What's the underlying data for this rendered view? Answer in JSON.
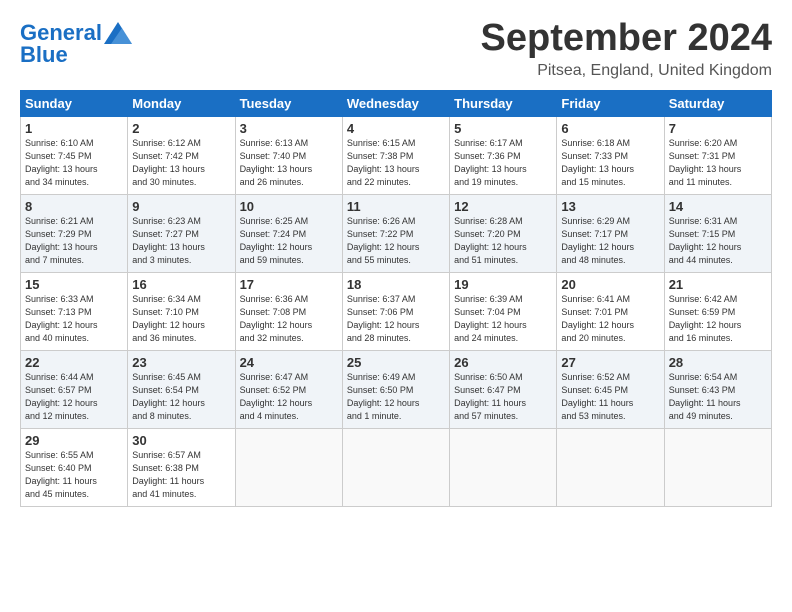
{
  "logo": {
    "line1": "General",
    "line2": "Blue"
  },
  "title": "September 2024",
  "location": "Pitsea, England, United Kingdom",
  "days_of_week": [
    "Sunday",
    "Monday",
    "Tuesday",
    "Wednesday",
    "Thursday",
    "Friday",
    "Saturday"
  ],
  "weeks": [
    [
      {
        "day": "1",
        "info": "Sunrise: 6:10 AM\nSunset: 7:45 PM\nDaylight: 13 hours\nand 34 minutes."
      },
      {
        "day": "2",
        "info": "Sunrise: 6:12 AM\nSunset: 7:42 PM\nDaylight: 13 hours\nand 30 minutes."
      },
      {
        "day": "3",
        "info": "Sunrise: 6:13 AM\nSunset: 7:40 PM\nDaylight: 13 hours\nand 26 minutes."
      },
      {
        "day": "4",
        "info": "Sunrise: 6:15 AM\nSunset: 7:38 PM\nDaylight: 13 hours\nand 22 minutes."
      },
      {
        "day": "5",
        "info": "Sunrise: 6:17 AM\nSunset: 7:36 PM\nDaylight: 13 hours\nand 19 minutes."
      },
      {
        "day": "6",
        "info": "Sunrise: 6:18 AM\nSunset: 7:33 PM\nDaylight: 13 hours\nand 15 minutes."
      },
      {
        "day": "7",
        "info": "Sunrise: 6:20 AM\nSunset: 7:31 PM\nDaylight: 13 hours\nand 11 minutes."
      }
    ],
    [
      {
        "day": "8",
        "info": "Sunrise: 6:21 AM\nSunset: 7:29 PM\nDaylight: 13 hours\nand 7 minutes."
      },
      {
        "day": "9",
        "info": "Sunrise: 6:23 AM\nSunset: 7:27 PM\nDaylight: 13 hours\nand 3 minutes."
      },
      {
        "day": "10",
        "info": "Sunrise: 6:25 AM\nSunset: 7:24 PM\nDaylight: 12 hours\nand 59 minutes."
      },
      {
        "day": "11",
        "info": "Sunrise: 6:26 AM\nSunset: 7:22 PM\nDaylight: 12 hours\nand 55 minutes."
      },
      {
        "day": "12",
        "info": "Sunrise: 6:28 AM\nSunset: 7:20 PM\nDaylight: 12 hours\nand 51 minutes."
      },
      {
        "day": "13",
        "info": "Sunrise: 6:29 AM\nSunset: 7:17 PM\nDaylight: 12 hours\nand 48 minutes."
      },
      {
        "day": "14",
        "info": "Sunrise: 6:31 AM\nSunset: 7:15 PM\nDaylight: 12 hours\nand 44 minutes."
      }
    ],
    [
      {
        "day": "15",
        "info": "Sunrise: 6:33 AM\nSunset: 7:13 PM\nDaylight: 12 hours\nand 40 minutes."
      },
      {
        "day": "16",
        "info": "Sunrise: 6:34 AM\nSunset: 7:10 PM\nDaylight: 12 hours\nand 36 minutes."
      },
      {
        "day": "17",
        "info": "Sunrise: 6:36 AM\nSunset: 7:08 PM\nDaylight: 12 hours\nand 32 minutes."
      },
      {
        "day": "18",
        "info": "Sunrise: 6:37 AM\nSunset: 7:06 PM\nDaylight: 12 hours\nand 28 minutes."
      },
      {
        "day": "19",
        "info": "Sunrise: 6:39 AM\nSunset: 7:04 PM\nDaylight: 12 hours\nand 24 minutes."
      },
      {
        "day": "20",
        "info": "Sunrise: 6:41 AM\nSunset: 7:01 PM\nDaylight: 12 hours\nand 20 minutes."
      },
      {
        "day": "21",
        "info": "Sunrise: 6:42 AM\nSunset: 6:59 PM\nDaylight: 12 hours\nand 16 minutes."
      }
    ],
    [
      {
        "day": "22",
        "info": "Sunrise: 6:44 AM\nSunset: 6:57 PM\nDaylight: 12 hours\nand 12 minutes."
      },
      {
        "day": "23",
        "info": "Sunrise: 6:45 AM\nSunset: 6:54 PM\nDaylight: 12 hours\nand 8 minutes."
      },
      {
        "day": "24",
        "info": "Sunrise: 6:47 AM\nSunset: 6:52 PM\nDaylight: 12 hours\nand 4 minutes."
      },
      {
        "day": "25",
        "info": "Sunrise: 6:49 AM\nSunset: 6:50 PM\nDaylight: 12 hours\nand 1 minute."
      },
      {
        "day": "26",
        "info": "Sunrise: 6:50 AM\nSunset: 6:47 PM\nDaylight: 11 hours\nand 57 minutes."
      },
      {
        "day": "27",
        "info": "Sunrise: 6:52 AM\nSunset: 6:45 PM\nDaylight: 11 hours\nand 53 minutes."
      },
      {
        "day": "28",
        "info": "Sunrise: 6:54 AM\nSunset: 6:43 PM\nDaylight: 11 hours\nand 49 minutes."
      }
    ],
    [
      {
        "day": "29",
        "info": "Sunrise: 6:55 AM\nSunset: 6:40 PM\nDaylight: 11 hours\nand 45 minutes."
      },
      {
        "day": "30",
        "info": "Sunrise: 6:57 AM\nSunset: 6:38 PM\nDaylight: 11 hours\nand 41 minutes."
      },
      {
        "day": "",
        "info": ""
      },
      {
        "day": "",
        "info": ""
      },
      {
        "day": "",
        "info": ""
      },
      {
        "day": "",
        "info": ""
      },
      {
        "day": "",
        "info": ""
      }
    ]
  ]
}
